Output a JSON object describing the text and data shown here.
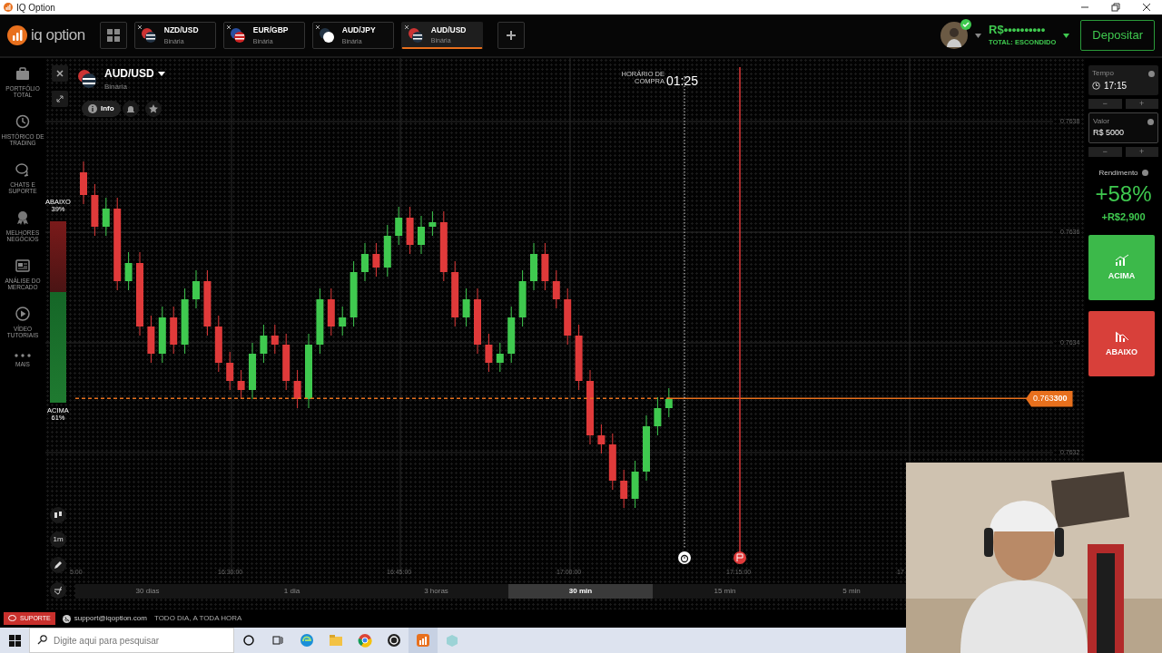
{
  "window": {
    "title": "IQ Option"
  },
  "header": {
    "logo": "iq option",
    "asset_tabs": [
      {
        "pair": "NZD/USD",
        "type": "Binária",
        "selected": false
      },
      {
        "pair": "EUR/GBP",
        "type": "Binária",
        "selected": false
      },
      {
        "pair": "AUD/JPY",
        "type": "Binária",
        "selected": false
      },
      {
        "pair": "AUD/USD",
        "type": "Binária",
        "selected": true
      }
    ],
    "account": {
      "verified": true,
      "balance": "R$••••••••••",
      "caption": "TOTAL: ESCONDIDO"
    },
    "deposit_button": "Depositar"
  },
  "sidebar": {
    "items": [
      {
        "label": "PORTFÓLIO TOTAL"
      },
      {
        "label": "HISTÓRICO DE TRADING"
      },
      {
        "label": "CHATS E SUPORTE"
      },
      {
        "label": "MELHORES NEGÓCIOS"
      },
      {
        "label": "ANÁLISE DO MERCADO"
      },
      {
        "label": "VÍDEO TUTORIAIS"
      },
      {
        "label": "MAIS"
      }
    ]
  },
  "chart": {
    "asset": "AUD/USD",
    "asset_type": "Binária",
    "info_button": "Info",
    "purchase_label": "HORÁRIO DE COMPRA",
    "countdown": "01:25",
    "price_tag": "0.763**300**",
    "price_labels": [
      "0.7638",
      "0.7636",
      "0.7634",
      "0.7632"
    ],
    "time_labels": [
      "5:00",
      "16:30:00",
      "16:45:00",
      "17:00:00",
      "17:15:00",
      "17"
    ],
    "sentiment": {
      "down_label": "ABAIXO",
      "down_pct": "39%",
      "up_label": "ACIMA",
      "up_pct": "61%",
      "level": 0.39
    },
    "timeframe_button": "1m",
    "ranges": [
      {
        "label": "30 dias",
        "selected": false
      },
      {
        "label": "1 dia",
        "selected": false
      },
      {
        "label": "3 horas",
        "selected": false
      },
      {
        "label": "30 min",
        "selected": true
      },
      {
        "label": "15 min",
        "selected": false
      },
      {
        "label": "5 min",
        "selected": false
      }
    ]
  },
  "trade_panel": {
    "time_label": "Tempo",
    "time_value": "17:15",
    "time_stepper": [
      "−",
      "+"
    ],
    "amount_label": "Valor",
    "amount_value": "R$ 5000",
    "amount_stepper": [
      "−",
      "+"
    ],
    "payout_label": "Rendimento",
    "payout_pct": "+58%",
    "payout_value": "+R$2,900",
    "up_button": "ACIMA",
    "down_button": "ABAIXO"
  },
  "support_bar": {
    "support_button": "SUPORTE",
    "email": "support@iqoption.com",
    "hours": "TODO DIA, A TODA HORA"
  },
  "taskbar": {
    "search_placeholder": "Digite aqui para pesquisar",
    "apps": [
      {
        "active": false
      },
      {
        "active": false
      },
      {
        "active": false
      },
      {
        "active": false
      },
      {
        "active": true
      },
      {
        "active": false
      }
    ]
  }
}
